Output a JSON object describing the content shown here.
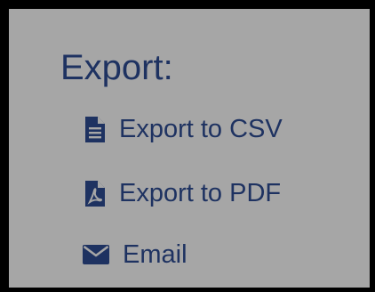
{
  "export_panel": {
    "title": "Export:",
    "accent_color": "#1e3261",
    "background_color": "#a6a6a6",
    "items": [
      {
        "label": "Export to CSV",
        "icon": "file-text-icon"
      },
      {
        "label": "Export to PDF",
        "icon": "file-pdf-icon"
      },
      {
        "label": "Email",
        "icon": "envelope-icon"
      }
    ]
  }
}
